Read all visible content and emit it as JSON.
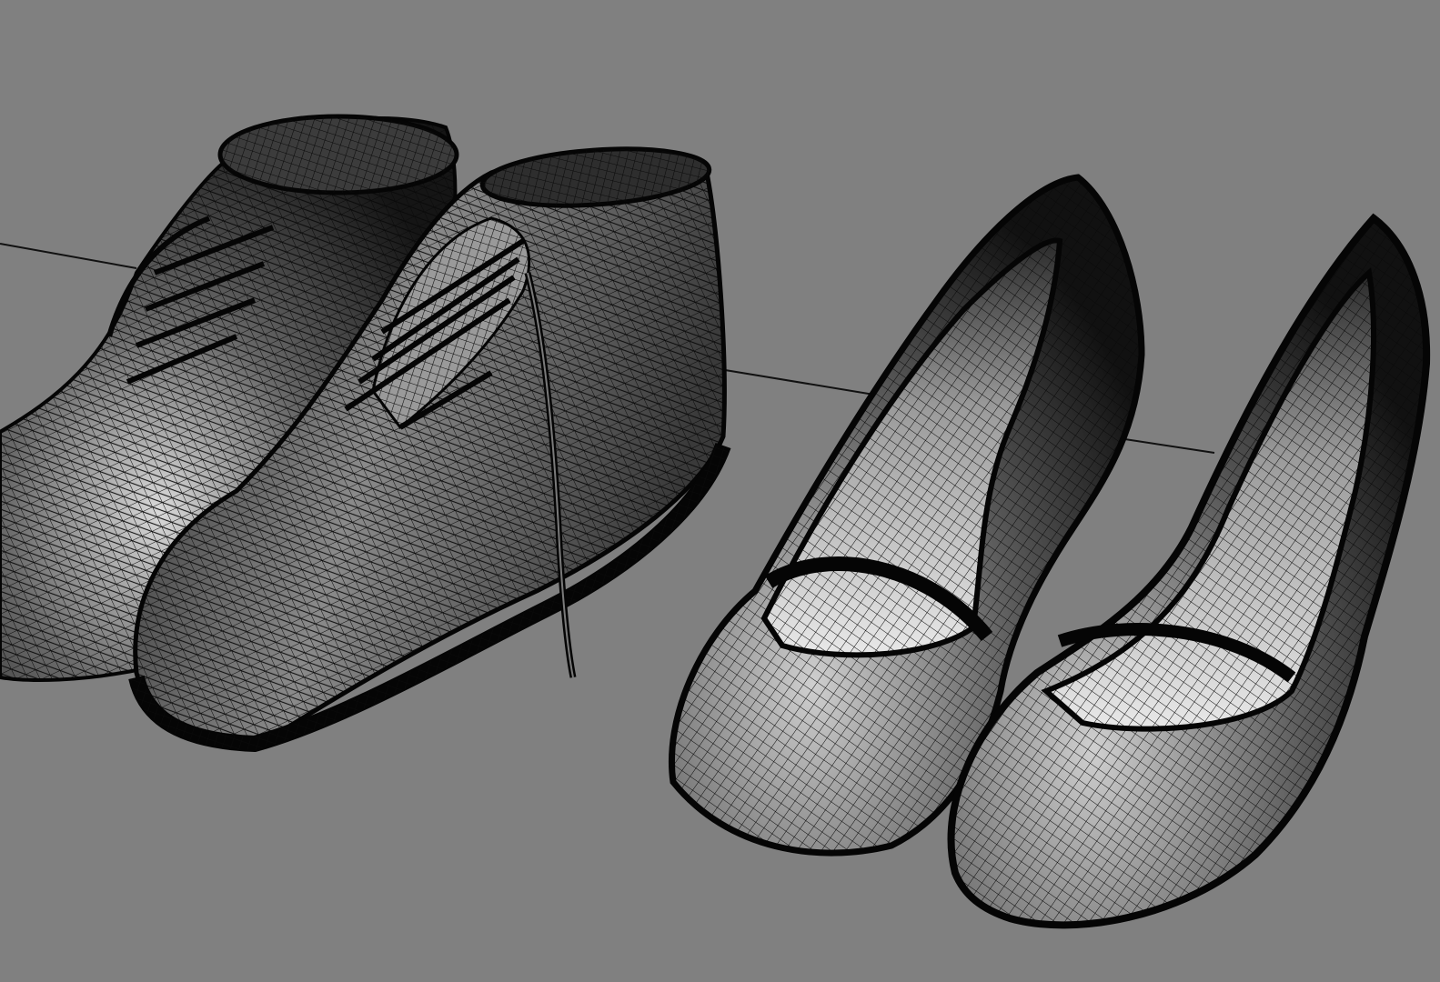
{
  "viewport": {
    "background": "#808080",
    "mesh_color": "#0a0a0a",
    "shade_light": "#d9d9d9",
    "shade_dark": "#111111",
    "display_mode": "wireframe-shaded",
    "objects": [
      {
        "name": "ankle-boot-left"
      },
      {
        "name": "ankle-boot-right"
      },
      {
        "name": "high-heel-left"
      },
      {
        "name": "high-heel-right"
      }
    ]
  }
}
